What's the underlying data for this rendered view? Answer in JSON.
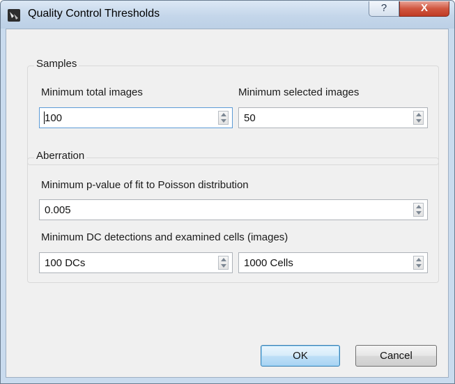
{
  "window": {
    "title": "Quality Control Thresholds",
    "help_glyph": "?",
    "close_glyph": "X"
  },
  "samples": {
    "group_title": "Samples",
    "min_total_label": "Minimum total images",
    "min_total_value": "100",
    "min_selected_label": "Minimum selected images",
    "min_selected_value": "50"
  },
  "aberration": {
    "group_title": "Aberration",
    "pvalue_label": "Minimum p-value of fit to Poisson distribution",
    "pvalue_value": "0.005",
    "dc_cells_label": "Minimum DC detections and examined cells (images)",
    "dc_value": "100 DCs",
    "cells_value": "1000 Cells"
  },
  "buttons": {
    "ok_label": "OK",
    "cancel_label": "Cancel"
  },
  "icons": [
    "app-icon",
    "help-icon",
    "close-icon",
    "spin-up-arrow-icon",
    "spin-down-arrow-icon"
  ],
  "colors": {
    "frame": "#c9dbee",
    "close": "#c03b25",
    "dialog": "#f0f0f0",
    "default_button": "#bfe0f7"
  }
}
